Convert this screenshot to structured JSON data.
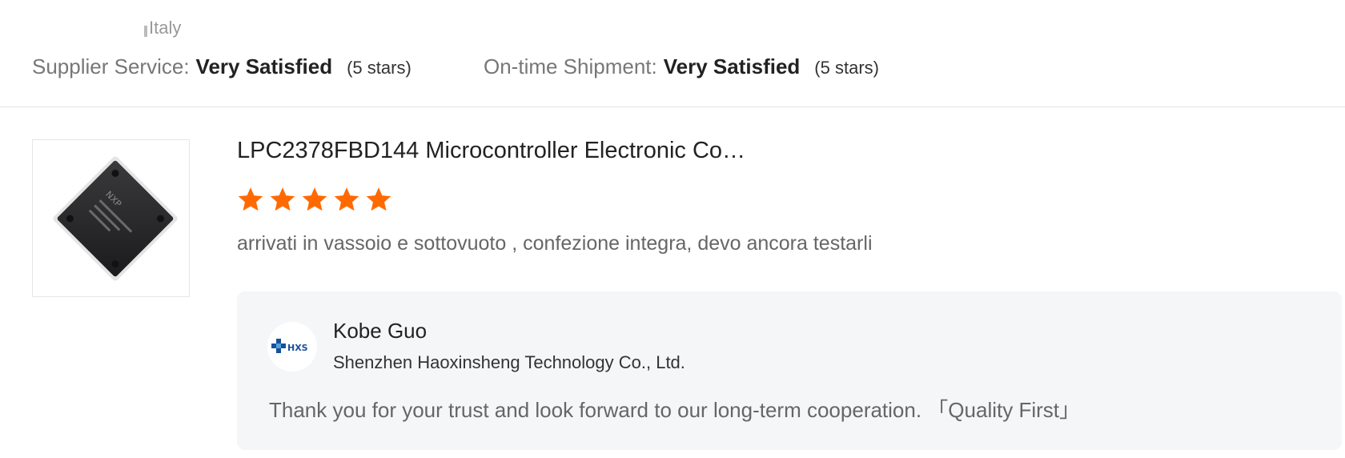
{
  "buyer": {
    "country": "Italy"
  },
  "ratings": {
    "supplier_service": {
      "label": "Supplier Service:",
      "value": "Very Satisfied",
      "stars_text": "(5 stars)"
    },
    "on_time_shipment": {
      "label": "On-time Shipment:",
      "value": "Very Satisfied",
      "stars_text": "(5 stars)"
    }
  },
  "review": {
    "product_title": "LPC2378FBD144 Microcontroller Electronic Co…",
    "star_rating": 5,
    "star_color": "#ff6a00",
    "text": "arrivati in vassoio e sottovuoto , confezione integra, devo ancora testarli",
    "product_chip_marking": "NXP"
  },
  "supplier_reply": {
    "logo_text": "HXS",
    "name": "Kobe Guo",
    "company": "Shenzhen Haoxinsheng Technology Co., Ltd.",
    "text": "Thank you for your trust and look forward to our long-term cooperation. 「Quality First」"
  }
}
